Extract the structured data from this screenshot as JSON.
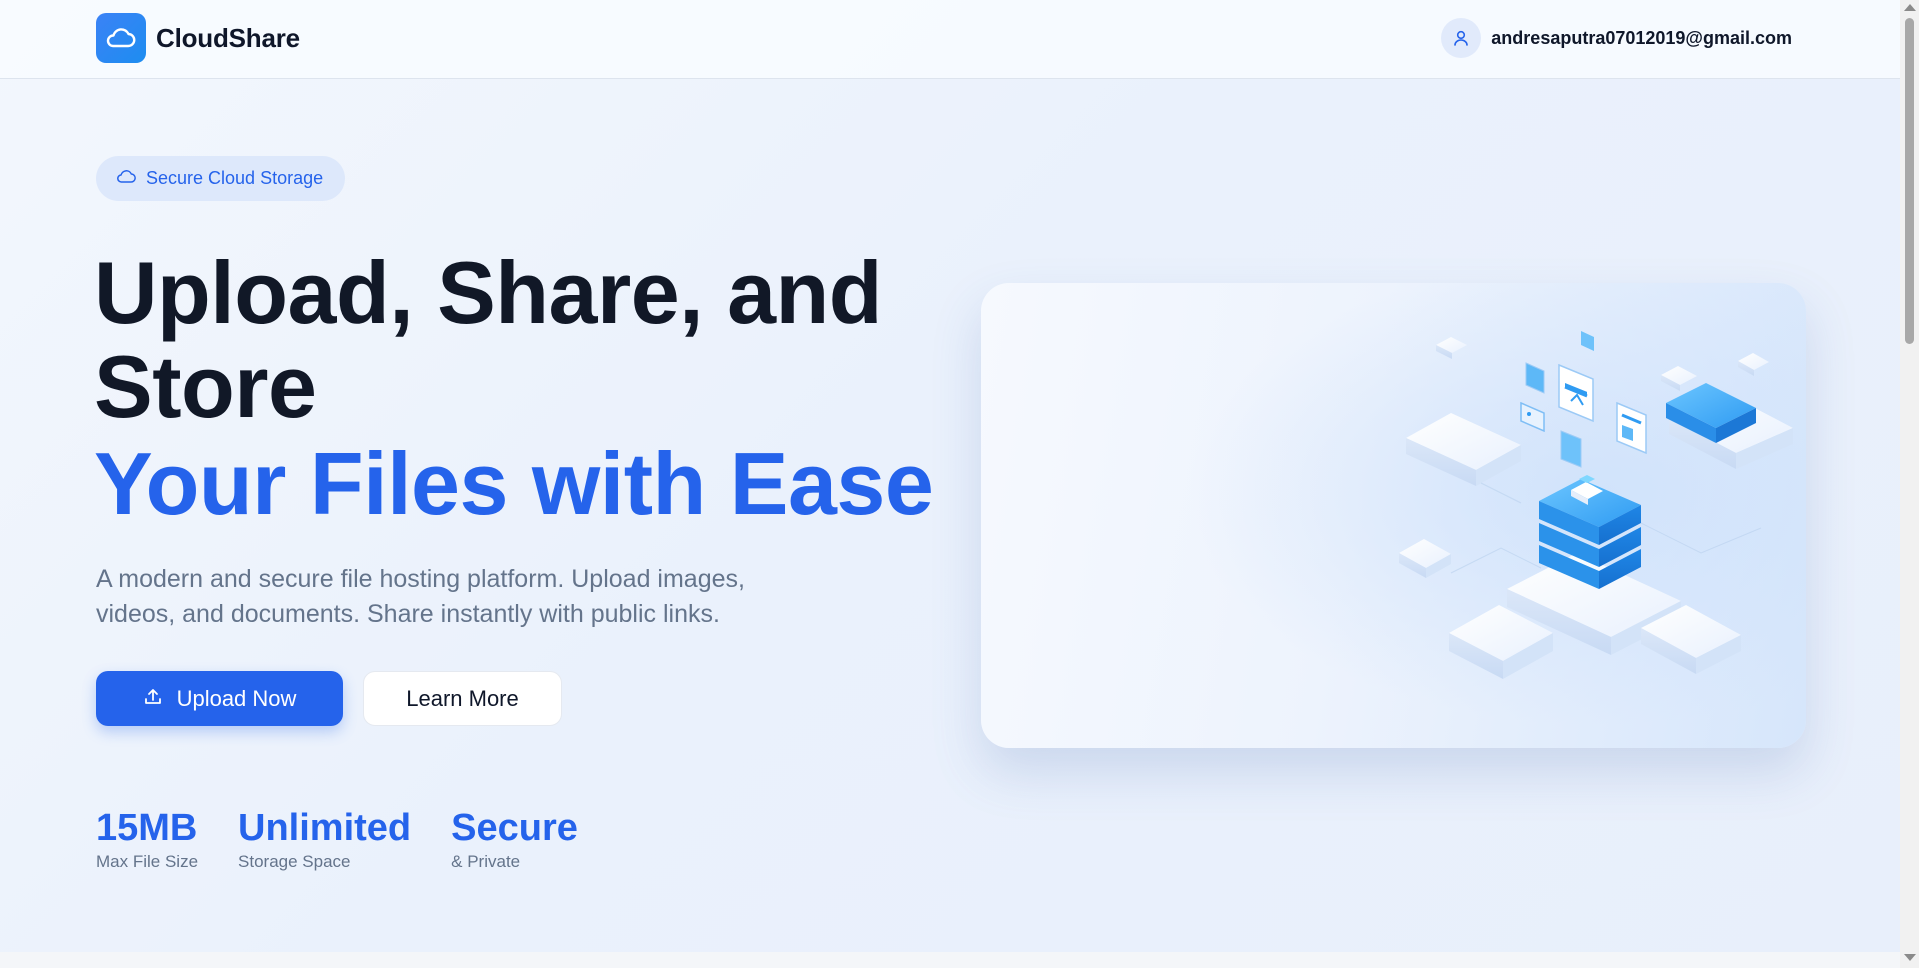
{
  "header": {
    "brand": "CloudShare",
    "user_email": "andresaputra07012019@gmail.com",
    "logo_icon": "cloud-icon",
    "user_icon": "user-icon"
  },
  "hero": {
    "badge": {
      "icon": "cloud-icon",
      "label": "Secure Cloud Storage"
    },
    "headline_line1": "Upload, Share, and",
    "headline_line2": "Store",
    "headline_highlight": "Your Files with Ease",
    "description_line1": "A modern and secure file hosting platform. Upload images,",
    "description_line2": "videos, and documents. Share instantly with public links.",
    "primary_button": {
      "icon": "upload-icon",
      "label": "Upload Now"
    },
    "secondary_button": {
      "label": "Learn More"
    },
    "stats": [
      {
        "value": "15MB",
        "label": "Max File Size"
      },
      {
        "value": "Unlimited",
        "label": "Storage Space"
      },
      {
        "value": "Secure",
        "label": "& Private"
      }
    ],
    "illustration": "isometric-cloud-storage-illustration"
  },
  "colors": {
    "accent": "#2563eb",
    "heading": "#111827",
    "muted": "#64748b",
    "badge_bg": "#dde8fb"
  }
}
